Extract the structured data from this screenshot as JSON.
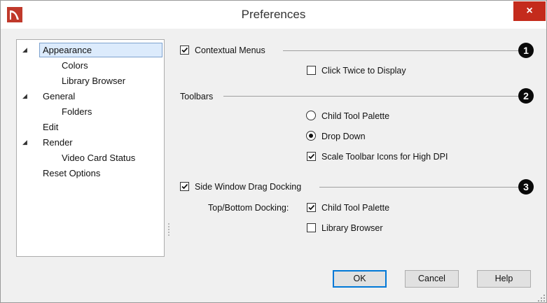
{
  "window": {
    "title": "Preferences",
    "close_glyph": "×",
    "app_icon": "app-logo-icon"
  },
  "tree": {
    "items": [
      {
        "label": "Appearance",
        "expanded": true,
        "selected": true
      },
      {
        "label": "Colors"
      },
      {
        "label": "Library Browser"
      },
      {
        "label": "General",
        "expanded": true
      },
      {
        "label": "Folders"
      },
      {
        "label": "Edit"
      },
      {
        "label": "Render",
        "expanded": true
      },
      {
        "label": "Video Card Status"
      },
      {
        "label": "Reset Options"
      }
    ],
    "expand_glyph": "◢"
  },
  "sections": {
    "contextual_menus": {
      "label": "Contextual Menus",
      "checked": true,
      "badge": "1"
    },
    "click_twice": {
      "label": "Click Twice to Display",
      "checked": false
    },
    "toolbars": {
      "label": "Toolbars",
      "badge": "2"
    },
    "child_tool_palette": {
      "label": "Child Tool Palette",
      "selected": false
    },
    "drop_down": {
      "label": "Drop Down",
      "selected": true
    },
    "scale_icons": {
      "label": "Scale Toolbar Icons for High DPI",
      "checked": true
    },
    "side_window_docking": {
      "label": "Side Window Drag Docking",
      "checked": true,
      "badge": "3"
    },
    "top_bottom_docking": {
      "label": "Top/Bottom Docking:"
    },
    "docking_child_tool_palette": {
      "label": "Child Tool Palette",
      "checked": true
    },
    "docking_library_browser": {
      "label": "Library Browser",
      "checked": false
    }
  },
  "buttons": {
    "ok": "OK",
    "cancel": "Cancel",
    "help": "Help"
  },
  "colors": {
    "close": "#c42b1c",
    "selection": "#dcebfc",
    "accent": "#0078d7",
    "app_icon": "#c0392b"
  }
}
